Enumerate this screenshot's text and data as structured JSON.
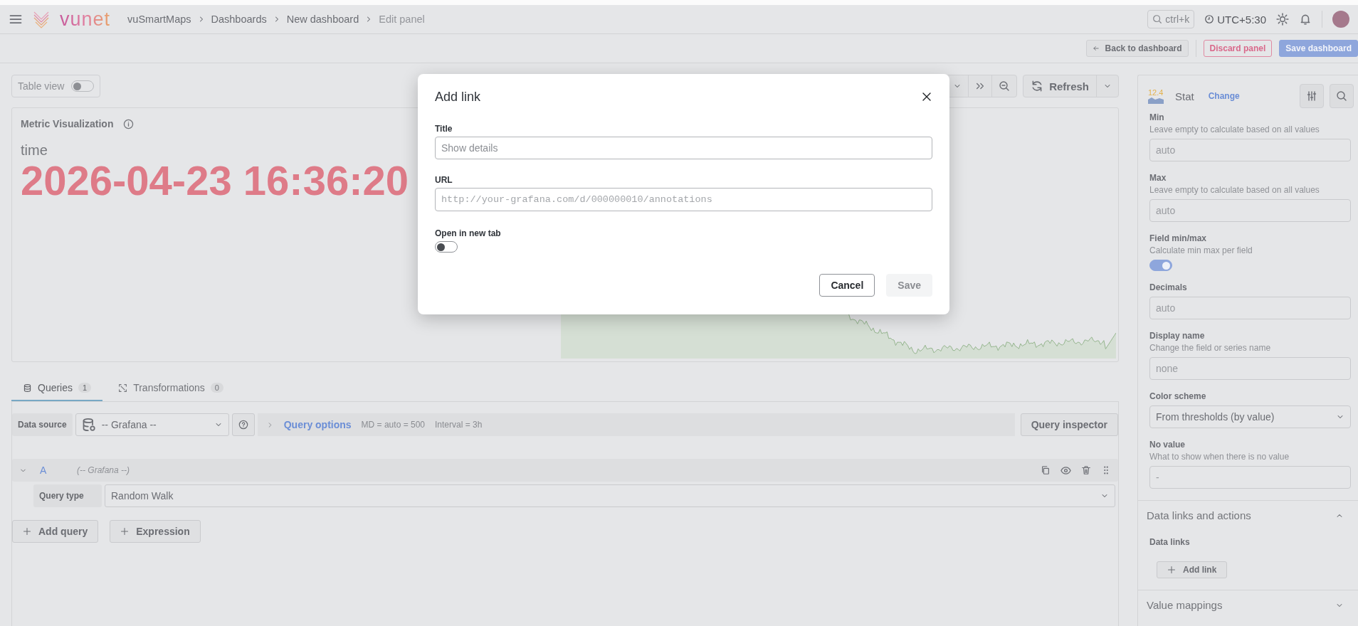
{
  "topbar": {
    "logo_text": "vunet",
    "breadcrumbs": [
      {
        "label": "vuSmartMaps"
      },
      {
        "label": "Dashboards"
      },
      {
        "label": "New dashboard"
      },
      {
        "label": "Edit panel"
      }
    ],
    "search": {
      "placeholder": "ctrl+k"
    },
    "timezone": "UTC+5:30"
  },
  "actions": [
    {
      "label": "Back to dashboard",
      "kind": "back"
    },
    {
      "label": "Discard panel",
      "kind": "danger"
    },
    {
      "label": "Save dashboard",
      "kind": "primary"
    }
  ],
  "table_view": {
    "label": "Table view",
    "on": false
  },
  "time_controls": {
    "refresh": "Refresh"
  },
  "panel": {
    "title": "Metric Visualization",
    "field": "time",
    "value": "2026-04-23 16:36:20"
  },
  "query_tabs": [
    {
      "label": "Queries",
      "count": "1",
      "selected": true
    },
    {
      "label": "Transformations",
      "count": "0",
      "selected": false
    }
  ],
  "data_source": {
    "label": "Data source",
    "value": "-- Grafana --"
  },
  "query_options": {
    "label": "Query options",
    "md": "MD = auto = 500",
    "interval": "Interval = 3h"
  },
  "query_inspector": "Query inspector",
  "query": {
    "ref": "A",
    "source": "(-- Grafana --)",
    "expanded": true,
    "type_label": "Query type",
    "type_value": "Random Walk"
  },
  "add_buttons": [
    {
      "label": "Add query"
    },
    {
      "label": "Expression"
    }
  ],
  "viz": {
    "icon_value": "12.4",
    "name": "Stat",
    "change": "Change"
  },
  "options": [
    {
      "kind": "input",
      "label": "Min",
      "description": "Leave empty to calculate based on all values",
      "placeholder": "auto"
    },
    {
      "kind": "input",
      "label": "Max",
      "description": "Leave empty to calculate based on all values",
      "placeholder": "auto"
    },
    {
      "kind": "switch",
      "label": "Field min/max",
      "description": "Calculate min max per field",
      "on": true
    },
    {
      "kind": "input",
      "label": "Decimals",
      "placeholder": "auto"
    },
    {
      "kind": "input",
      "label": "Display name",
      "description": "Change the field or series name",
      "placeholder": "none"
    },
    {
      "kind": "select",
      "label": "Color scheme",
      "value": "From thresholds (by value)"
    },
    {
      "kind": "input",
      "label": "No value",
      "description": "What to show when there is no value",
      "placeholder": "-"
    }
  ],
  "sections": [
    {
      "title": "Data links and actions",
      "expanded": true,
      "sublabel": "Data links",
      "button": "Add link"
    },
    {
      "title": "Value mappings",
      "expanded": false
    }
  ],
  "modal": {
    "title": "Add link",
    "fields": [
      {
        "label": "Title",
        "placeholder": "Show details",
        "kind": "text"
      },
      {
        "label": "URL",
        "placeholder": "http://your-grafana.com/d/000000010/annotations",
        "kind": "url"
      }
    ],
    "switch": {
      "label": "Open in new tab",
      "on": false
    },
    "buttons": [
      {
        "label": "Cancel",
        "kind": "secondary"
      },
      {
        "label": "Save",
        "kind": "disabled"
      }
    ]
  }
}
